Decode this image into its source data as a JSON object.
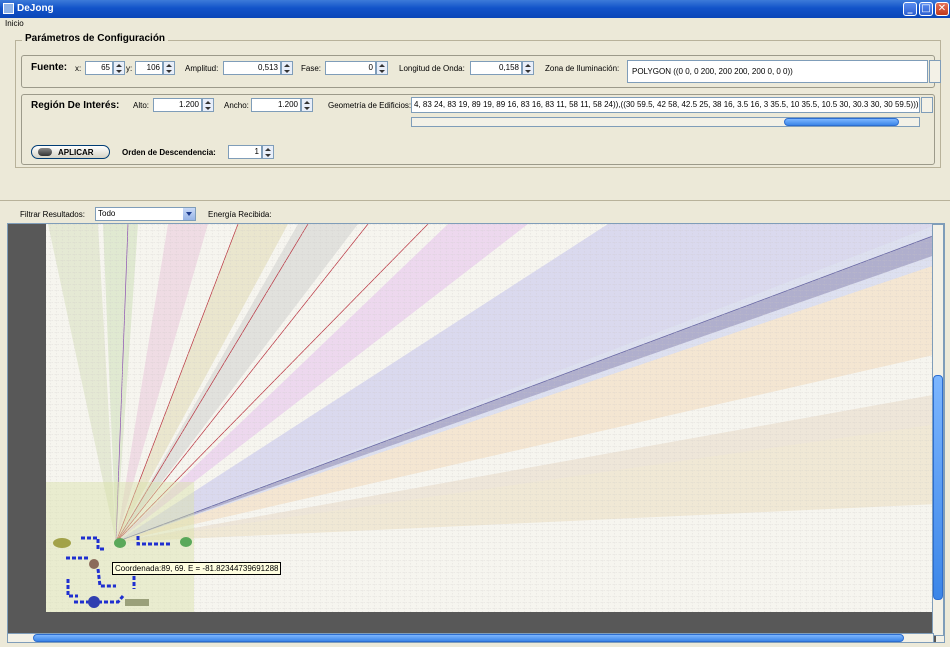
{
  "window": {
    "title": "DeJong"
  },
  "menu": {
    "inicio": "Inicio"
  },
  "config": {
    "legend": "Parámetros de Configuración",
    "fuente": {
      "label": "Fuente:",
      "x_label": "x:",
      "x_value": "65",
      "y_label": "y:",
      "y_value": "106",
      "amplitud_label": "Amplitud:",
      "amplitud_value": "0,513",
      "fase_label": "Fase:",
      "fase_value": "0",
      "longitud_label": "Longitud de Onda:",
      "longitud_value": "0,158",
      "zona_label": "Zona de Iluminación:",
      "zona_value": "POLYGON ((0 0, 0 200, 200 200, 200 0, 0 0))"
    },
    "region": {
      "label": "Región De Interés:",
      "alto_label": "Alto:",
      "alto_value": "1.200",
      "ancho_label": "Ancho:",
      "ancho_value": "1.200",
      "geometria_label": "Geometría de Edificios:",
      "geometria_value": "4, 83 24, 83 19, 89 19, 89 16, 83 16, 83 11, 58 11, 58 24)),((30 59.5, 42 58, 42.5 25, 38 16, 3.5 16, 3 35.5, 10 35.5, 10.5 30, 30.3 30, 30 59.5)))",
      "orden_label": "Orden de Descendencia:",
      "orden_value": "1",
      "apply_label": "APLICAR"
    }
  },
  "filter": {
    "label": "Filtrar Resultados:",
    "selected": "Todo",
    "energy_label": "Energía Recibida:"
  },
  "tooltip": {
    "text": "Coordenada:89, 69. E = -81.82344739691288"
  },
  "colors": {
    "titlebar": "#0a46b8",
    "scroll_thumb": "#3c86e8",
    "building": "#1f2fd0"
  }
}
